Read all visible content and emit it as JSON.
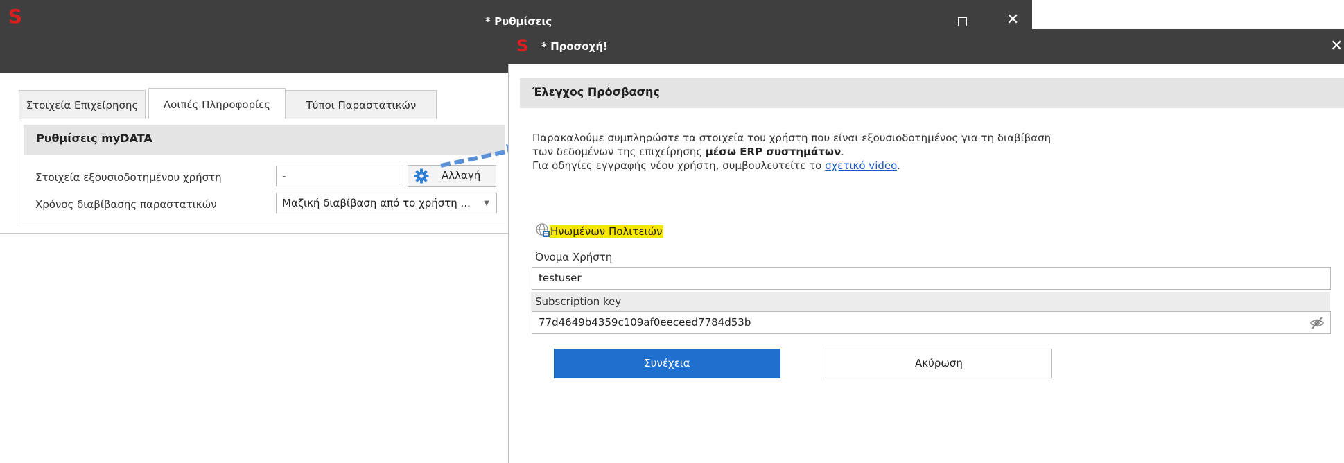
{
  "settings_window": {
    "title": "* Ρυθμίσεις",
    "app_logo_glyph": "S",
    "close_glyph": "✕",
    "tabs": [
      {
        "label": "Στοιχεία Επιχείρησης",
        "active": false
      },
      {
        "label": "Λοιπές Πληροφορίες",
        "active": true
      },
      {
        "label": "Τύποι Παραστατικών",
        "active": false
      }
    ],
    "panel_title": "Ρυθμίσεις myDATA",
    "rows": {
      "user_label": "Στοιχεία εξουσιοδοτημένου χρήστη",
      "user_value": "-",
      "change_button": "Αλλαγή",
      "read_time_label": "Χρόνος διαβίβασης παραστατικών",
      "read_time_value": "Μαζική διαβίβαση από το χρήστη ..."
    }
  },
  "dialog": {
    "title": "* Προσοχή!",
    "app_logo_glyph": "S",
    "close_glyph": "✕",
    "section_title": "Έλεγχος Πρόσβασης",
    "message_line1": "Παρακαλούμε συμπληρώστε τα στοιχεία του χρήστη που είναι εξουσιοδοτημένος για τη διαβίβαση",
    "message_line2_prefix": "των δεδομένων της επιχείρησης ",
    "message_line2_bold": "μέσω ERP συστημάτων",
    "message_line2_suffix": ".",
    "message_line3_prefix": "Για οδηγίες εγγραφής νέου χρήστη, συμβουλευτείτε το ",
    "message_link": "σχετικό video",
    "message_line3_suffix": ".",
    "auth_provider": "Ηνωμένων Πολιτειών",
    "username_label": "Όνομα Χρήστη",
    "username_value": "testuser",
    "subscription_label": "Subscription key",
    "subscription_value": "77d4649b4359c109af0eeceed7784d53b",
    "continue_button": "Συνέχεια",
    "cancel_button": "Ακύρωση"
  },
  "colors": {
    "titlebar": "#3f3f3f",
    "brand_red": "#d81e1e",
    "primary_button": "#1f6fcf",
    "arrow": "#5b8fd6",
    "highlight": "#f7e600"
  }
}
